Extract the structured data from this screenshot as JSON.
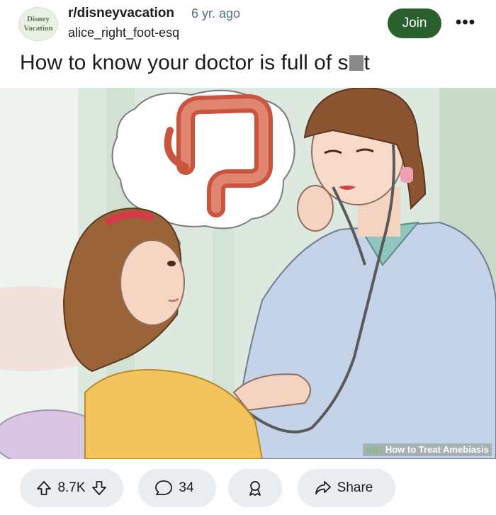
{
  "post": {
    "subreddit": "r/disneyvacation",
    "age": "6 yr. ago",
    "username": "alice_right_foot-esq",
    "avatar_text_line1": "Disney",
    "avatar_text_line2": "Vacation",
    "join_label": "Join",
    "more_label": "•••",
    "title_prefix": "How to know your doctor is full of s",
    "title_suffix": "t"
  },
  "image": {
    "watermark_brand": "wiki",
    "watermark_text": "How to Treat Amebiasis"
  },
  "actions": {
    "upvotes": "8.7K",
    "comments": "34",
    "share_label": "Share"
  },
  "icons": {
    "upvote": "arrow-up-icon",
    "downvote": "arrow-down-icon",
    "comment": "comment-icon",
    "award": "award-icon",
    "share": "share-icon"
  },
  "colors": {
    "join_button": "#2a5f2e",
    "pill_background": "#eaedef",
    "meta_text": "#576f76"
  }
}
